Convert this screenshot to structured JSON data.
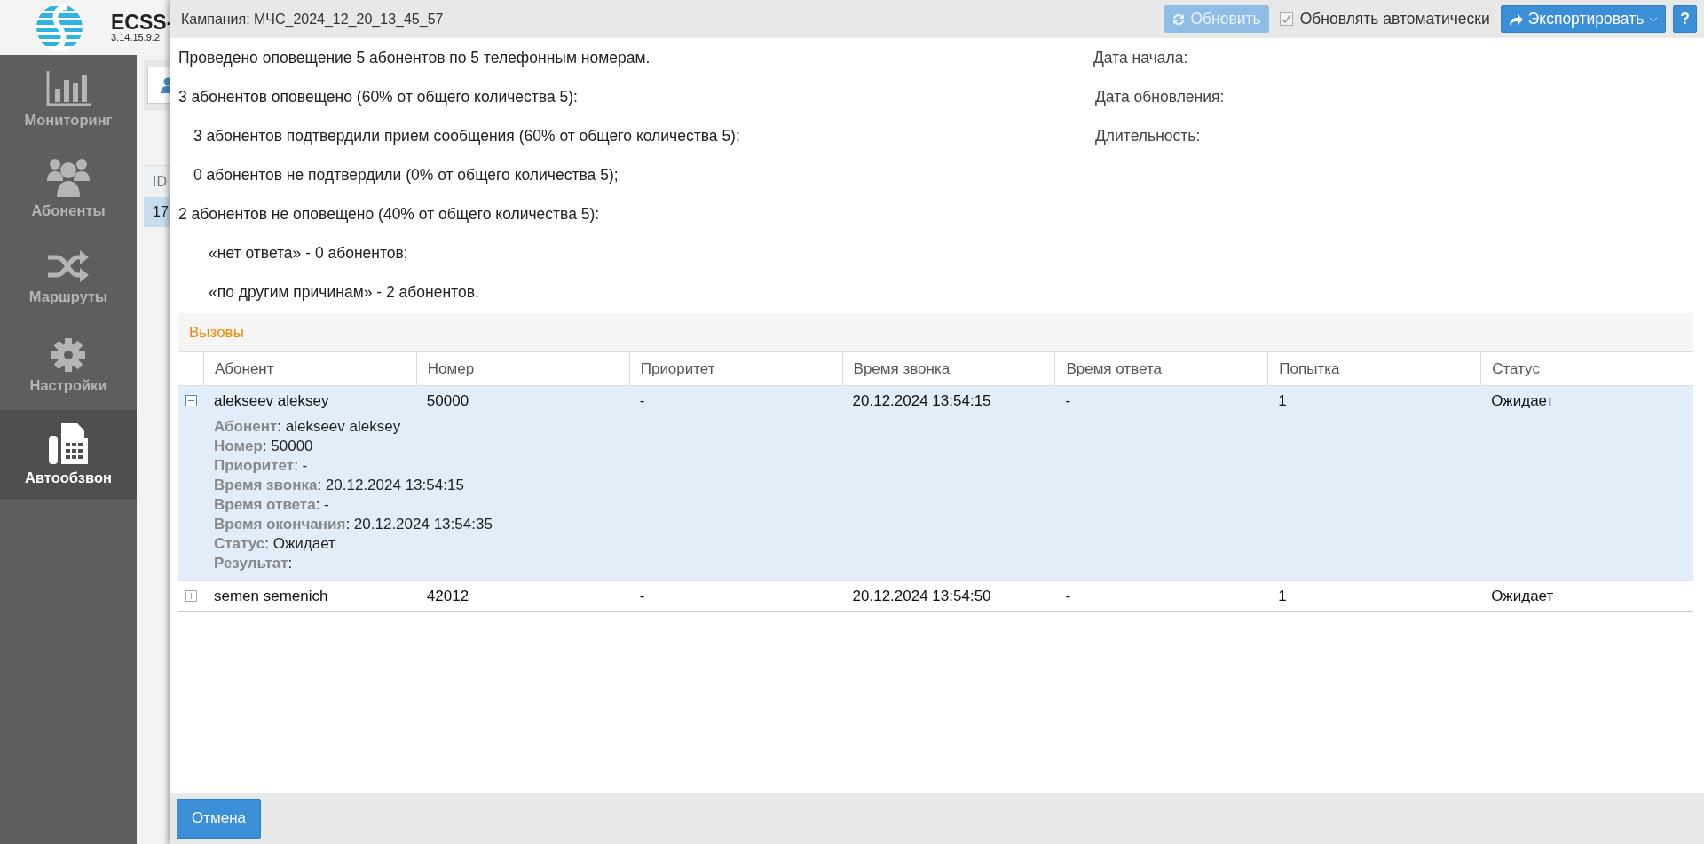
{
  "app": {
    "title": "ECSS-",
    "version": "3.14.15.9.2"
  },
  "sidebar": {
    "items": [
      {
        "label": "Мониторинг",
        "kind": "chart",
        "selected": false
      },
      {
        "label": "Абоненты",
        "kind": "people",
        "selected": false
      },
      {
        "label": "Маршруты",
        "kind": "shuffle",
        "selected": false
      },
      {
        "label": "Настройки",
        "kind": "gear",
        "selected": false
      },
      {
        "label": "Автообзвон",
        "kind": "phone",
        "selected": true
      }
    ]
  },
  "background_table": {
    "column_1": "ID",
    "rows": [
      "17"
    ]
  },
  "dialog": {
    "title": "Кампания: МЧС_2024_12_20_13_45_57",
    "refresh_button": {
      "label": "Обновить",
      "disabled": true
    },
    "auto_update": {
      "label": "Обновлять автоматически",
      "checked": true
    },
    "export_button": "Экспортировать",
    "help_button": "?",
    "summary": [
      {
        "kind": "main",
        "text": "Проведено оповещение 5 абонентов по 5 телефонным номерам."
      },
      {
        "kind": "main",
        "text": "3 абонентов оповещено (60% от общего количества 5):"
      },
      {
        "kind": "sub",
        "text": "3 абонентов подтвердили прием сообщения (60% от общего количества 5);"
      },
      {
        "kind": "sub",
        "text": "0 абонентов не подтвердили (0% от общего количества 5);"
      },
      {
        "kind": "main",
        "text": "2 абонентов не оповещено (40% от общего количества 5):"
      },
      {
        "kind": "reason",
        "text": "«нет ответа» - 0 абонентов;"
      },
      {
        "kind": "reason",
        "text": "«по другим причинам» - 2 абонентов."
      }
    ],
    "dates": [
      "Дата начала:",
      "Дата обновления:",
      "Длительность:"
    ],
    "calls": {
      "title": "Вызовы",
      "columns": [
        "Абонент",
        "Номер",
        "Приоритет",
        "Время звонка",
        "Время ответа",
        "Попытка",
        "Статус"
      ],
      "rows": [
        {
          "expanded": true,
          "cells": [
            "alekseev aleksey",
            "50000",
            "-",
            "20.12.2024 13:54:15",
            "-",
            "1",
            "Ожидает"
          ],
          "details": [
            "**Абонент**: alekseev aleksey",
            "**Номер**: 50000",
            "**Приоритет**: -",
            "**Время звонка**: 20.12.2024 13:54:15",
            "**Время ответа**: -",
            "**Время окончания**: 20.12.2024 13:54:35",
            "**Статус**: Ожидает",
            "**Результат**:"
          ]
        },
        {
          "expanded": false,
          "cells": [
            "semen semenich",
            "42012",
            "-",
            "20.12.2024 13:54:50",
            "-",
            "1",
            "Ожидает"
          ]
        }
      ]
    },
    "cancel_button": "Отмена"
  }
}
